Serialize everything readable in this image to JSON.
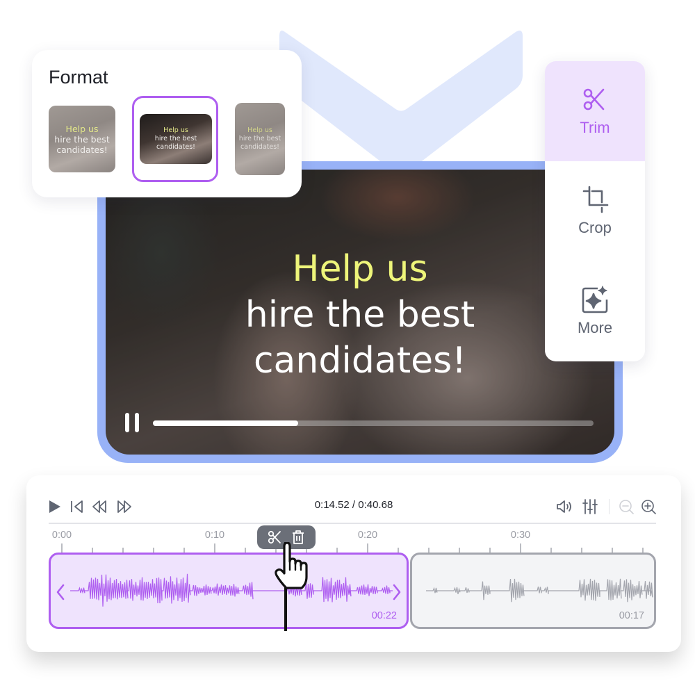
{
  "format_panel": {
    "title": "Format",
    "options": [
      {
        "name": "square",
        "selected": false,
        "caption_line1": "Help us",
        "caption_line2": "hire the best",
        "caption_line3": "candidates!"
      },
      {
        "name": "landscape",
        "selected": true,
        "caption_line1": "Help us",
        "caption_line2": "hire the best",
        "caption_line3": "candidates!"
      },
      {
        "name": "portrait",
        "selected": false,
        "caption_line1": "Help us",
        "caption_line2": "hire the best",
        "caption_line3": "candidates!"
      }
    ]
  },
  "video": {
    "caption_line1": "Help us",
    "caption_line2": "hire the best",
    "caption_line3": "candidates!",
    "state": "playing",
    "progress_percent": 33
  },
  "tools_panel": {
    "items": [
      {
        "label": "Trim",
        "icon": "scissors-icon",
        "active": true
      },
      {
        "label": "Crop",
        "icon": "crop-icon",
        "active": false
      },
      {
        "label": "More",
        "icon": "sparkle-icon",
        "active": false
      }
    ]
  },
  "timeline": {
    "controls": {
      "play": "play-icon",
      "skip_start": "skip-to-start-icon",
      "rewind": "rewind-icon",
      "fast_forward": "fast-forward-icon",
      "volume": "volume-icon",
      "mixer": "sliders-icon",
      "zoom_out": "zoom-out-icon",
      "zoom_in": "zoom-in-icon"
    },
    "current_time": "0:14.52",
    "total_time": "0:40.68",
    "time_readout": "0:14.52 / 0:40.68",
    "tick_labels": [
      "0:00",
      "0:10",
      "0:20",
      "0:30"
    ],
    "tick_interval_seconds": 2,
    "label_interval_seconds": 10,
    "clips": [
      {
        "duration_label": "00:22",
        "selected": true
      },
      {
        "duration_label": "00:17",
        "selected": false
      }
    ],
    "clip_actions": [
      "scissors-icon",
      "trash-icon"
    ]
  },
  "colors": {
    "accent": "#ae5ef0",
    "accent_light": "#efe3fd",
    "frame_blue": "#98b2f7",
    "chevron_blue": "#e0e8fc",
    "caption_yellow": "#eef57a",
    "neutral_icon": "#5f6572"
  }
}
